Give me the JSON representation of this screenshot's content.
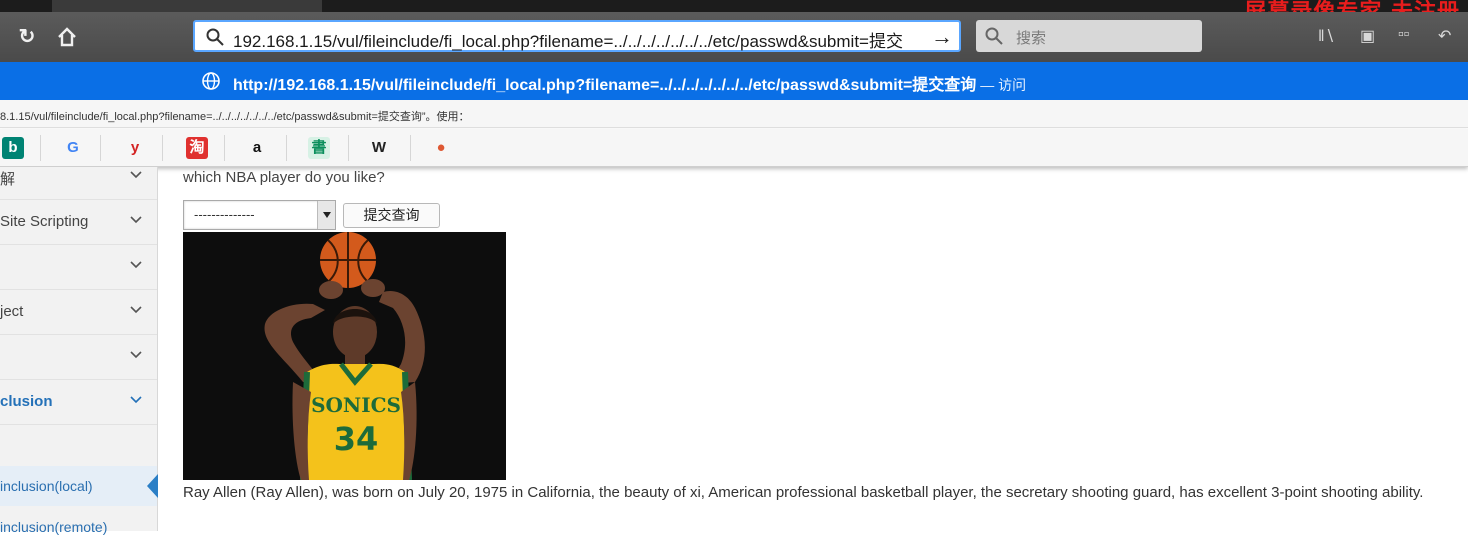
{
  "browser": {
    "watermark": "屏幕录像专家 未注册",
    "address_url": "192.168.1.15/vul/fileinclude/fi_local.php?filename=../../../../../../../etc/passwd&submit=提交",
    "search_placeholder": "搜索",
    "suggestion_url": "http://192.168.1.15/vul/fileinclude/fi_local.php?filename=../../../../../../../etc/passwd&submit=提交查询",
    "suggestion_action": " — 访问",
    "status_text": "8.1.15/vul/fileinclude/fi_local.php?filename=../../../../../../../etc/passwd&submit=提交查询”。使用："
  },
  "bookmarks": [
    {
      "name": "bing",
      "glyph": "b",
      "color": "#ffffff",
      "bg": "#008373"
    },
    {
      "name": "google",
      "glyph": "G",
      "color": "#4285f4",
      "bg": "transparent"
    },
    {
      "name": "yelp",
      "glyph": "y",
      "color": "#d32323",
      "bg": "transparent"
    },
    {
      "name": "taobao",
      "glyph": "淘",
      "color": "#ffffff",
      "bg": "#e0312f"
    },
    {
      "name": "amazon",
      "glyph": "a",
      "color": "#111111",
      "bg": "transparent"
    },
    {
      "name": "book",
      "glyph": "書",
      "color": "#0b8f5c",
      "bg": "#d7f1e5"
    },
    {
      "name": "wikipedia",
      "glyph": "W",
      "color": "#222222",
      "bg": "transparent"
    },
    {
      "name": "duckduckgo",
      "glyph": "●",
      "color": "#de5833",
      "bg": "transparent"
    }
  ],
  "sidebar": {
    "items": [
      {
        "label": "解"
      },
      {
        "label": "Site Scripting"
      },
      {
        "label": ""
      },
      {
        "label": "ject"
      },
      {
        "label": ""
      },
      {
        "label": "clusion"
      }
    ],
    "subitems": [
      {
        "label": "inclusion(local)"
      },
      {
        "label": "inclusion(remote)"
      }
    ]
  },
  "main": {
    "question": "which NBA player do you like?",
    "select_value": "--------------",
    "submit_label": "提交查询",
    "player_number": "34",
    "jersey_text": "SONICS",
    "caption": "Ray Allen (Ray Allen), was born on July 20, 1975 in California, the beauty of xi, American professional basketball player, the secretary shooting guard, has excellent 3-point shooting ability."
  },
  "colors": {
    "accent": "#0a6fe6",
    "sidebar_active": "#2471b8",
    "jersey_yellow": "#f4c21b",
    "jersey_green": "#1d6b3a"
  }
}
